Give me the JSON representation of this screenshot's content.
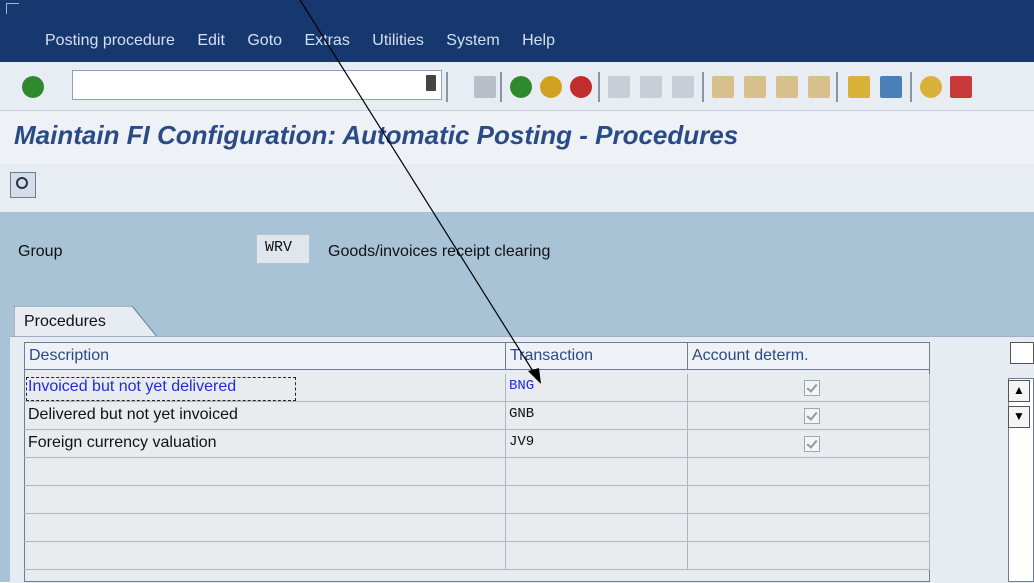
{
  "menu": [
    "Posting procedure",
    "Edit",
    "Goto",
    "Extras",
    "Utilities",
    "System",
    "Help"
  ],
  "title": "Maintain FI Configuration: Automatic Posting - Procedures",
  "group": {
    "label": "Group",
    "code": "WRV",
    "description": "Goods/invoices receipt clearing"
  },
  "tab": "Procedures",
  "table": {
    "headers": [
      "Description",
      "Transaction",
      "Account determ."
    ],
    "rows": [
      {
        "description": "Invoiced but not yet delivered",
        "transaction": "BNG",
        "account_determ": true
      },
      {
        "description": "Delivered but not yet invoiced",
        "transaction": "GNB",
        "account_determ": true
      },
      {
        "description": "Foreign currency valuation",
        "transaction": "JV9",
        "account_determ": true
      }
    ]
  },
  "colors": {
    "menubar": "#17386f",
    "title": "#2a4b85",
    "work_area": "#a9c3d6",
    "selected_row_text": "#1f2be0"
  }
}
